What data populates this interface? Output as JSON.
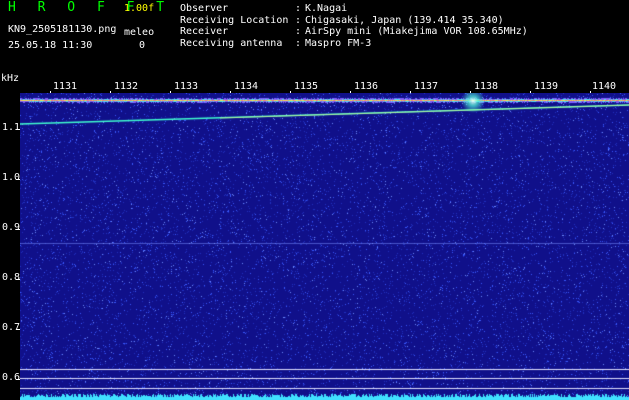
{
  "header": {
    "app_title": "H R O F F T",
    "version": "1.00f",
    "filename": "KN9_2505181130.png",
    "meleo_label": "meleo",
    "timestamp": "25.05.18 11:30",
    "meleo_value": "0"
  },
  "info": [
    {
      "label": "Observer",
      "sep": ":",
      "value": "K.Nagai"
    },
    {
      "label": "Receiving Location",
      "sep": ":",
      "value": "Chigasaki, Japan (139.414 35.340)"
    },
    {
      "label": "Receiver",
      "sep": ":",
      "value": "AirSpy mini (Miakejima VOR 108.65MHz)"
    },
    {
      "label": "Receiving antenna",
      "sep": ":",
      "value": "Maspro FM-3"
    }
  ],
  "axes": {
    "y_unit": "kHz",
    "y_ticks": [
      "1.1",
      "1.0",
      "0.9",
      "0.8",
      "0.7",
      "0.6"
    ],
    "x_ticks": [
      "1131",
      "1132",
      "1133",
      "1134",
      "1135",
      "1136",
      "1137",
      "1138",
      "1139",
      "1140"
    ]
  },
  "colors": {
    "background": "#10108a",
    "noise": "#3a5aff",
    "carrier": "#ffe040",
    "signal": "#40ffd0",
    "title": "#00ff00",
    "version": "#ffff00"
  }
}
